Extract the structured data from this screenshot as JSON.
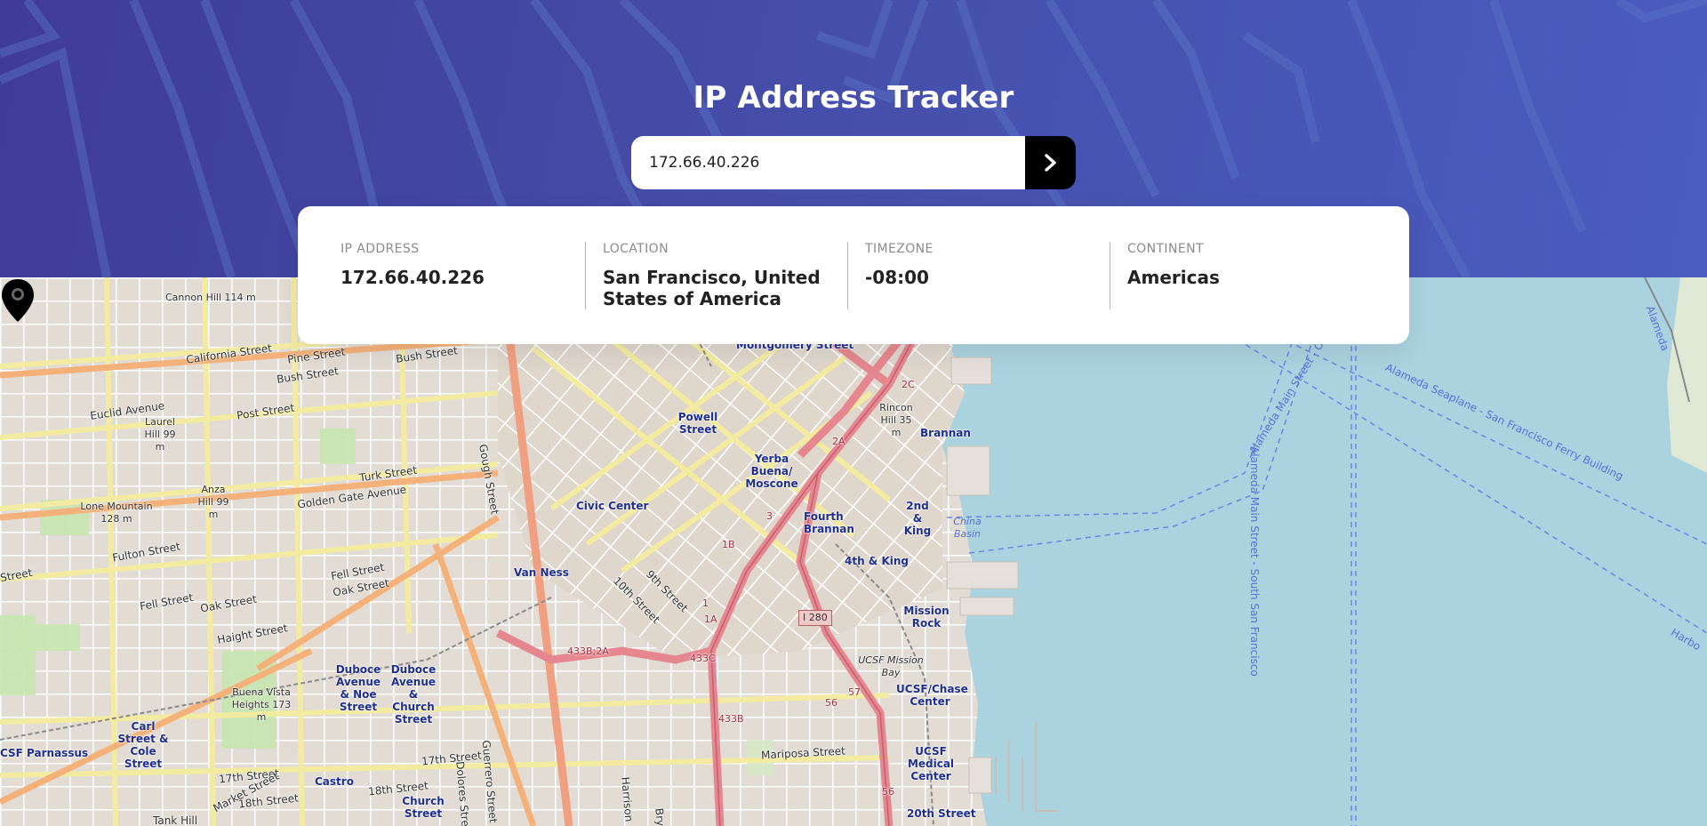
{
  "header": {
    "title": "IP Address Tracker"
  },
  "search": {
    "value": "172.66.40.226",
    "button_icon": "chevron-right-icon"
  },
  "info": {
    "ip": {
      "label": "IP ADDRESS",
      "value": "172.66.40.226"
    },
    "location": {
      "label": "LOCATION",
      "value": "San Francisco, United States of America"
    },
    "timezone": {
      "label": "TIMEZONE",
      "value": "-08:00"
    },
    "continent": {
      "label": "CONTINENT",
      "value": "Americas"
    }
  },
  "map": {
    "pin_icon": "location-pin-icon",
    "labels": {
      "cannon_hill": "Cannon Hill 114 m",
      "california_st": "California Street",
      "pine_st": "Pine Street",
      "bush_st": "Bush Street",
      "bush_st2": "Bush Street",
      "montgomery": "Montgomery Street",
      "euclid": "Euclid Avenue",
      "laurel_hill": "Laurel Hill 99 m",
      "post_st": "Post Street",
      "powell": "Powell Street",
      "rincon_hill": "Rincon Hill 35 m",
      "brannan": "Brannan",
      "yerba_buena": "Yerba Buena/ Moscone",
      "anza_hill": "Anza Hill 99 m",
      "turk_st": "Turk Street",
      "golden_gate": "Golden Gate Avenue",
      "gough_st": "Gough Street",
      "lone_mountain": "Lone Mountain 128 m",
      "civic_center": "Civic Center",
      "fourth_brannan": "Fourth Brannan",
      "second_king": "2nd & King",
      "china_basin": "China Basin",
      "fulton_st": "Fulton Street",
      "fell_st": "Fell Street",
      "oak_st": "Oak Street",
      "fell_st2": "Fell Street",
      "oak_st2": "Oak Street",
      "van_ness": "Van Ness",
      "fourth_king": "4th & King",
      "tenth_st": "10th Street",
      "ninth_st": "9th Street",
      "i280": "I 280",
      "mission_rock": "Mission Rock",
      "haight_st": "Haight Street",
      "street": "Street",
      "duboce_noe": "Duboce Avenue & Noe Street",
      "duboce_church": "Duboce Avenue & Church Street",
      "ucsf_mission_bay": "UCSF Mission Bay",
      "ucsf_chase": "UCSF/Chase Center",
      "buena_vista": "Buena Vista Heights 173 m",
      "carl_cole": "Carl Street & Cole Street",
      "ucsf_parnassus": "CSF Parnassus",
      "seventeenth_st": "17th Street",
      "seventeenth_st2": "17th Street",
      "eighteenth_st": "18th Street",
      "eighteenth_st2": "18th Street",
      "market_st": "Market Street",
      "castro": "Castro",
      "church_street": "Church Street",
      "dolores": "Dolores Street",
      "guerrero": "Guerrero Street",
      "harrison": "Harrison",
      "bry": "Bry",
      "mariposa": "Mariposa Street",
      "ucsf_medical": "UCSF Medical Center",
      "twentieth_st": "20th Street",
      "tank_hill": "Tank Hill",
      "alameda_main": "Alameda Main Street - South San Francisco",
      "alameda_seaplane": "Alameda Seaplane - San Francisco Ferry Building",
      "alameda_main2": "Alameda Main Street - Oa",
      "alameda": "Alameda",
      "harbo": "Harbo",
      "r_433b2a": "433B;2A",
      "r_433c": "433C",
      "r_433b": "433B",
      "r_1b": "1B",
      "r_1a": "1A",
      "r_1": "1",
      "r_2a": "2A",
      "r_2c": "2C",
      "r_57": "57",
      "r_56": "56",
      "r_56b": "56",
      "r_3": "3"
    }
  }
}
